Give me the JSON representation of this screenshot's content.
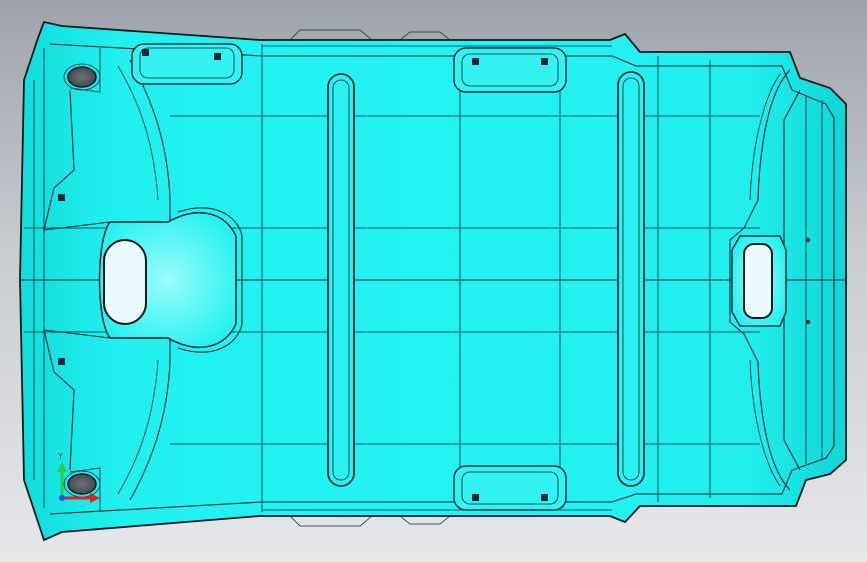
{
  "viewport": {
    "background_top": "#9ea3ab",
    "background_bottom": "#e6e7e9"
  },
  "part": {
    "surface_color": "#22f0f0",
    "surface_highlight": "#8ffbfb",
    "edge_color": "#0a2b31"
  },
  "triad": {
    "y_label": "Y",
    "y_color": "#2ecc40",
    "x_color": "#e02020",
    "icons": [
      "coordinate-triad-icon"
    ]
  }
}
